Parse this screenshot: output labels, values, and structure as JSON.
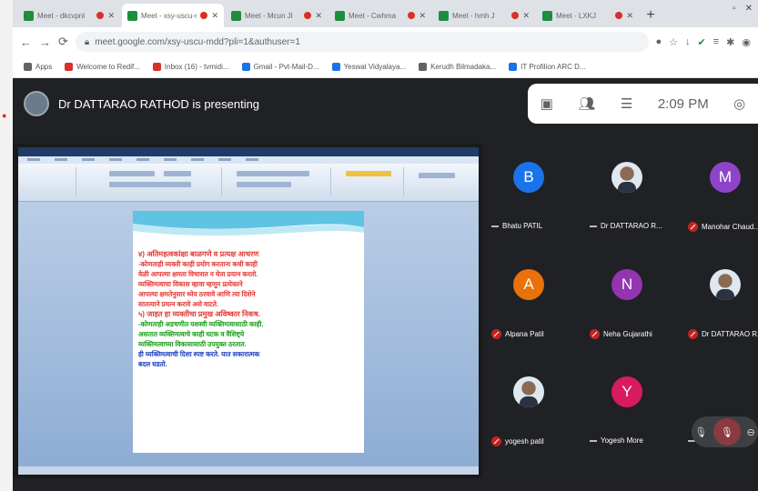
{
  "browser": {
    "tabs": [
      {
        "title": "Meet - dkcvpnl",
        "active": false
      },
      {
        "title": "Meet - xsy-uscu-mdd",
        "active": true
      },
      {
        "title": "Meet - Mcun JI",
        "active": false
      },
      {
        "title": "Meet - Cwhma",
        "active": false
      },
      {
        "title": "Meet - hmh J",
        "active": false
      },
      {
        "title": "Meet - LXKJ",
        "active": false
      }
    ],
    "new_tab": "+",
    "url": "meet.google.com/xsy-uscu-mdd?pli=1&authuser=1",
    "bookmarks": [
      {
        "label": "Apps",
        "color": "#5f6368"
      },
      {
        "label": "Welcome to Redif...",
        "color": "#d93025"
      },
      {
        "label": "Inbox (16) - tvmidi...",
        "color": "#d93025"
      },
      {
        "label": "Gmail - Pvt-Mail-D...",
        "color": "#1a73e8"
      },
      {
        "label": "Yeswal Vidyalaya...",
        "color": "#1a73e8"
      },
      {
        "label": "Kerudh Bilmadaka...",
        "color": "#5f6368"
      },
      {
        "label": "IT Profilion ARC D...",
        "color": "#1a73e8"
      }
    ]
  },
  "meet": {
    "presenter_text": "Dr DATTARAO RATHOD is presenting",
    "clock": "2:09 PM",
    "participants": [
      {
        "name": "Bhatu PATIL",
        "initial": "B",
        "color": "#1a73e8",
        "muted": false,
        "photo": false
      },
      {
        "name": "Dr DATTARAO R...",
        "initial": "",
        "color": "",
        "muted": false,
        "photo": true
      },
      {
        "name": "Manohar Chaud...",
        "initial": "M",
        "color": "#8e44c9",
        "muted": true,
        "photo": false
      },
      {
        "name": "Alpana Patil",
        "initial": "A",
        "color": "#e8710a",
        "muted": true,
        "photo": false
      },
      {
        "name": "Neha Gujarathi",
        "initial": "N",
        "color": "#9334b0",
        "muted": true,
        "photo": false
      },
      {
        "name": "Dr DATTARAO R...",
        "initial": "",
        "color": "",
        "muted": true,
        "photo": true
      },
      {
        "name": "yogesh patil",
        "initial": "",
        "color": "",
        "muted": true,
        "photo": true
      },
      {
        "name": "Yogesh More",
        "initial": "Y",
        "color": "#d81b60",
        "muted": false,
        "photo": false
      },
      {
        "name": "Yogesh More",
        "initial": "",
        "color": "",
        "muted": false,
        "photo": false
      }
    ]
  },
  "document": {
    "lines": [
      {
        "text": "४) अतिमहत्वकांक्षा बाळगणे व प्रत्यक्ष आचरण",
        "cls": "red head"
      },
      {
        "text": "-कोणताही व्यक्ती काही प्रयोग करताना कधी काही",
        "cls": "red"
      },
      {
        "text": "वेळी आपल्या क्षमता विचारात न घेता प्रयत्न करतो.",
        "cls": "red"
      },
      {
        "text": "व्यक्तिमत्वाचा विकास व्हावा म्हणून प्रत्येकाने",
        "cls": "red"
      },
      {
        "text": "आपल्या क्षमतेनुसार ध्येय ठरवावे आणि त्या दिशेने",
        "cls": "red"
      },
      {
        "text": "सातत्याने प्रयत्न करावे असे वाटते.",
        "cls": "red"
      },
      {
        "text": "५) जाहत हा व्यक्तीचा प्रमुख अविष्कार निकष.",
        "cls": "red head"
      },
      {
        "text": "-कोणताही अडचणीत यशस्वी व्यक्तिमत्वासाठी काही.",
        "cls": "green"
      },
      {
        "text": "असतात व्यक्तिमत्वाचे काही घटक व वैशिष्ट्ये",
        "cls": "green"
      },
      {
        "text": "व्यक्तिमत्वाच्या विकासासाठी उपयुक्त ठरतात.",
        "cls": "green"
      },
      {
        "text": "ही व्यक्तिमत्वाची दिशा स्पष्ट करते. यात सकारात्मक",
        "cls": "blue"
      },
      {
        "text": "बदल घडतो.",
        "cls": "blue"
      }
    ]
  }
}
